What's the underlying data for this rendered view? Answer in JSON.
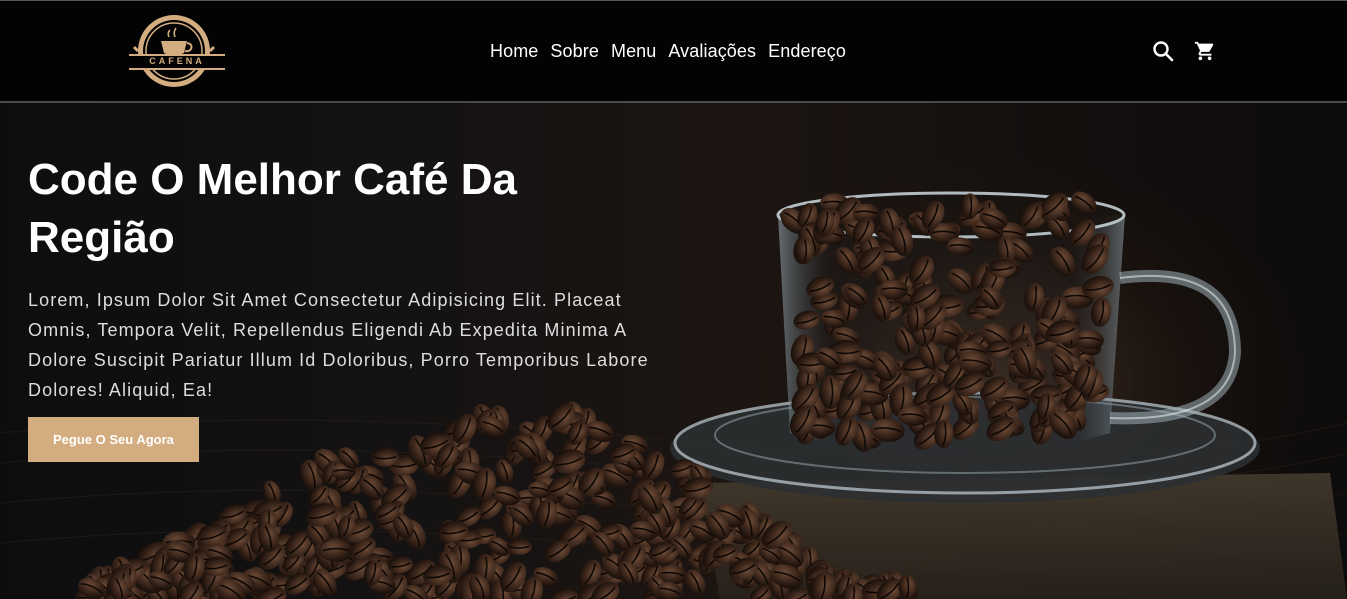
{
  "brand": {
    "logo_text": "CAFENA",
    "logo_icon": "coffee-cup-icon",
    "accent_color": "#d3ad7f"
  },
  "nav": {
    "items": [
      {
        "label": "Home"
      },
      {
        "label": "Sobre"
      },
      {
        "label": "Menu"
      },
      {
        "label": "Avaliações"
      },
      {
        "label": "Endereço"
      }
    ]
  },
  "header_icons": {
    "search": "search-icon",
    "cart": "cart-icon"
  },
  "hero": {
    "title": "Code O Melhor Café Da Região",
    "text": "Lorem, Ipsum Dolor Sit Amet Consectetur Adipisicing Elit. Placeat Omnis, Tempora Velit, Repellendus Eligendi Ab Expedita Minima A Dolore Suscipit Pariatur Illum Id Doloribus, Porro Temporibus Labore Dolores! Aliquid, Ea!",
    "cta_label": "Pegue O Seu Agora",
    "image": "coffee-beans-glass-cup-image"
  }
}
